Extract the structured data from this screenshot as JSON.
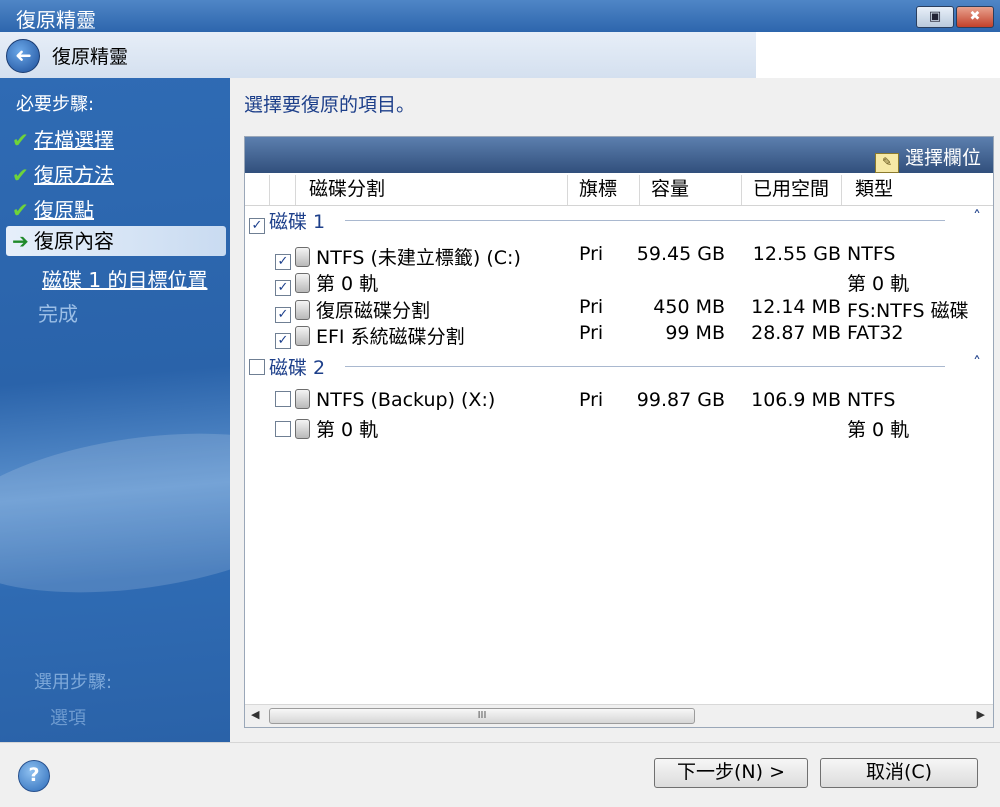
{
  "window": {
    "title": "復原精靈",
    "restore_glyph": "▣",
    "close_glyph": "✖"
  },
  "nav": {
    "back_glyph": "➜",
    "title": "復原精靈"
  },
  "sidebar": {
    "header": "必要步驟:",
    "steps": [
      {
        "label": "存檔選擇",
        "state": "done"
      },
      {
        "label": "復原方法",
        "state": "done"
      },
      {
        "label": "復原點",
        "state": "done"
      },
      {
        "label": "復原內容",
        "state": "current"
      },
      {
        "label": "磁碟 1 的目標位置",
        "state": "link"
      },
      {
        "label": "完成",
        "state": "disabled"
      }
    ],
    "check_glyph": "✔",
    "arrow_glyph": "➔",
    "optional_header": "選用步驟:",
    "optional_item": "選項"
  },
  "main": {
    "prompt": "選擇要復原的項目。",
    "choose_columns": "選擇欄位",
    "columns": [
      "磁碟分割",
      "旗標",
      "容量",
      "已用空間",
      "類型"
    ],
    "groups": [
      {
        "label": "磁碟 1",
        "checked": true,
        "rows": [
          {
            "name": "NTFS (未建立標籤) (C:)",
            "flag": "Pri",
            "capacity": "59.45 GB",
            "used": "12.55 GB",
            "type": "NTFS",
            "checked": true
          },
          {
            "name": "第 0 軌",
            "flag": "",
            "capacity": "",
            "used": "",
            "type": "第 0 軌",
            "checked": true
          },
          {
            "name": "復原磁碟分割",
            "flag": "Pri",
            "capacity": "450 MB",
            "used": "12.14 MB",
            "type": "FS:NTFS 磁碟",
            "checked": true
          },
          {
            "name": "EFI 系統磁碟分割",
            "flag": "Pri",
            "capacity": "99 MB",
            "used": "28.87 MB",
            "type": "FAT32",
            "checked": true
          }
        ]
      },
      {
        "label": "磁碟 2",
        "checked": false,
        "rows": [
          {
            "name": "NTFS (Backup) (X:)",
            "flag": "Pri",
            "capacity": "99.87 GB",
            "used": "106.9 MB",
            "type": "NTFS",
            "checked": false
          },
          {
            "name": "第 0 軌",
            "flag": "",
            "capacity": "",
            "used": "",
            "type": "第 0 軌",
            "checked": false
          }
        ]
      }
    ],
    "caret_glyph": "˄",
    "scroll_left": "◀",
    "scroll_right": "▶",
    "scroll_grip": "III"
  },
  "footer": {
    "help_glyph": "?",
    "next": "下一步(N) >",
    "cancel": "取消(C)"
  }
}
